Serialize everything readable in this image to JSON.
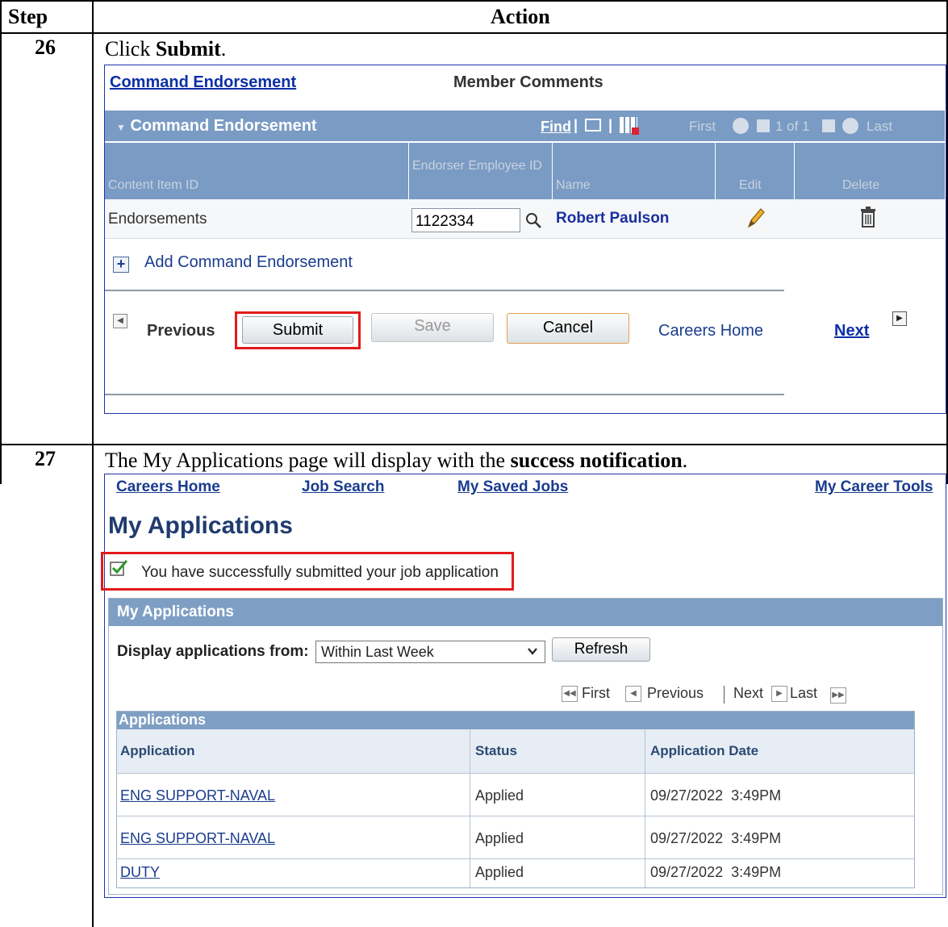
{
  "table": {
    "header_step": "Step",
    "header_action": "Action"
  },
  "step26": {
    "number": "26",
    "instruction_prefix": "Click ",
    "instruction_bold": "Submit",
    "instruction_suffix": ".",
    "screen": {
      "tab_active": "Command Endorsement",
      "tab_other": "Member Comments",
      "grid": {
        "title": "Command Endorsement",
        "find_label": "Find",
        "pager_first": "First",
        "pager_count": "1 of 1",
        "pager_last": "Last",
        "columns": [
          "Content Item ID",
          "Endorser Employee ID",
          "Name",
          "Edit",
          "Delete"
        ],
        "row": {
          "content_item": "Endorsements",
          "employee_id": "1122334",
          "name": "Robert Paulson"
        }
      },
      "add_label": "Add Command Endorsement",
      "nav": {
        "previous": "Previous",
        "submit": "Submit",
        "save": "Save",
        "cancel": "Cancel",
        "careers_home": "Careers Home",
        "next": "Next"
      }
    }
  },
  "step27": {
    "number": "27",
    "instruction_prefix": "The My Applications page will display with the ",
    "instruction_bold": "success notification",
    "instruction_suffix": ".",
    "screen": {
      "nav_links": [
        "Careers Home",
        "Job Search",
        "My Saved Jobs",
        "My Career Tools"
      ],
      "page_title": "My Applications",
      "success_message": "You have successfully submitted your job application",
      "panel_title": "My Applications",
      "filter_label": "Display applications from:",
      "filter_value": "Within Last Week",
      "refresh_label": "Refresh",
      "pager": {
        "first": "First",
        "previous": "Previous",
        "next": "Next",
        "last": "Last"
      },
      "applications_title": "Applications",
      "columns": [
        "Application",
        "Status",
        "Application Date"
      ],
      "rows": [
        {
          "application": "ENG SUPPORT-NAVAL",
          "status": "Applied",
          "date": "09/27/2022  3:49PM"
        },
        {
          "application": "ENG SUPPORT-NAVAL",
          "status": "Applied",
          "date": "09/27/2022  3:49PM"
        },
        {
          "application": "DUTY",
          "status": "Applied",
          "date": "09/27/2022  3:49PM"
        }
      ]
    }
  },
  "colors": {
    "grid_header": "#7a9bc4",
    "panel_header": "#7e9fc3",
    "highlight": "#e21b1b",
    "link": "#0c2fa7"
  }
}
